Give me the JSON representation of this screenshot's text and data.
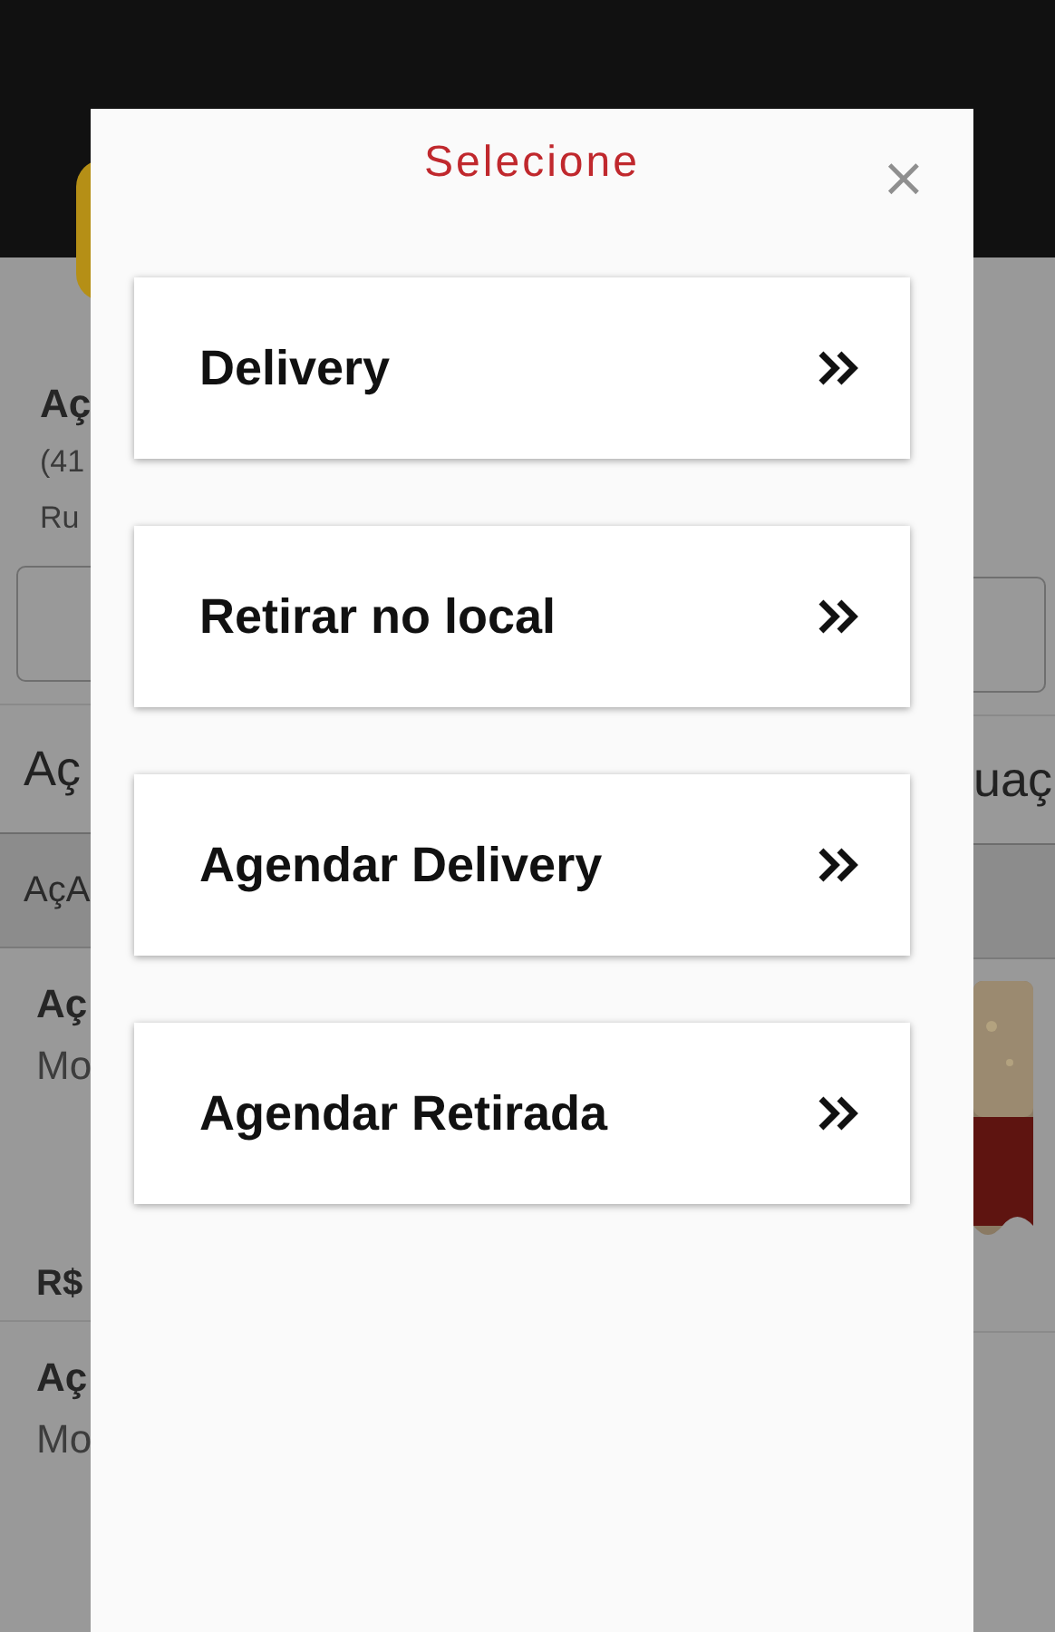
{
  "store": {
    "name": "Aç",
    "phone": "(41",
    "address": "Ru"
  },
  "tabs": [
    {
      "label": "Aç"
    },
    {
      "label": "uaç"
    }
  ],
  "section": "AçA",
  "products": [
    {
      "name": "Aç",
      "description": "Mo",
      "price": "R$",
      "kind": "picture"
    },
    {
      "name": "Aç",
      "description": "Mo"
    }
  ],
  "modal": {
    "title": "Selecione",
    "close": "×",
    "options": [
      {
        "label": "Delivery"
      },
      {
        "label": "Retirar no local"
      },
      {
        "label": "Agendar Delivery"
      },
      {
        "label": "Agendar Retirada"
      }
    ]
  }
}
